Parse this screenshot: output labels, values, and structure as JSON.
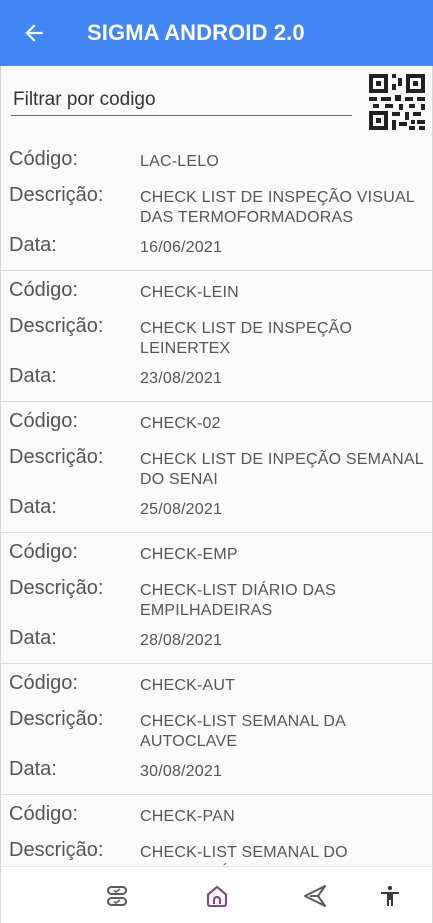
{
  "appbar": {
    "title": "SIGMA ANDROID 2.0"
  },
  "filter": {
    "placeholder": "Filtrar por codigo",
    "value": ""
  },
  "labels": {
    "codigo": "Código:",
    "descricao": "Descrição:",
    "data": "Data:"
  },
  "items": [
    {
      "codigo": "LAC-LELO",
      "descricao": "CHECK LIST DE INSPEÇÃO VISUAL DAS TERMOFORMADORAS",
      "data": "16/06/2021"
    },
    {
      "codigo": "CHECK-LEIN",
      "descricao": "CHECK LIST DE INSPEÇÃO LEINERTEX",
      "data": "23/08/2021"
    },
    {
      "codigo": "CHECK-02",
      "descricao": "CHECK LIST DE INPEÇÃO SEMANAL DO SENAI",
      "data": "25/08/2021"
    },
    {
      "codigo": "CHECK-EMP",
      "descricao": "CHECK-LIST DIÁRIO DAS EMPILHADEIRAS",
      "data": "28/08/2021"
    },
    {
      "codigo": "CHECK-AUT",
      "descricao": "CHECK-LIST SEMANAL DA AUTOCLAVE",
      "data": "30/08/2021"
    },
    {
      "codigo": "CHECK-PAN",
      "descricao": "CHECK-LIST SEMANAL DO PANTOGRÁFO",
      "data": ""
    }
  ],
  "bottom_nav": {
    "icons": [
      "tasks-icon",
      "home-icon",
      "send-icon",
      "accessibility-icon"
    ]
  },
  "colors": {
    "appbar": "#4285f4",
    "nav_icon": "#5a5a5a",
    "home_icon": "#7b4f7f"
  }
}
